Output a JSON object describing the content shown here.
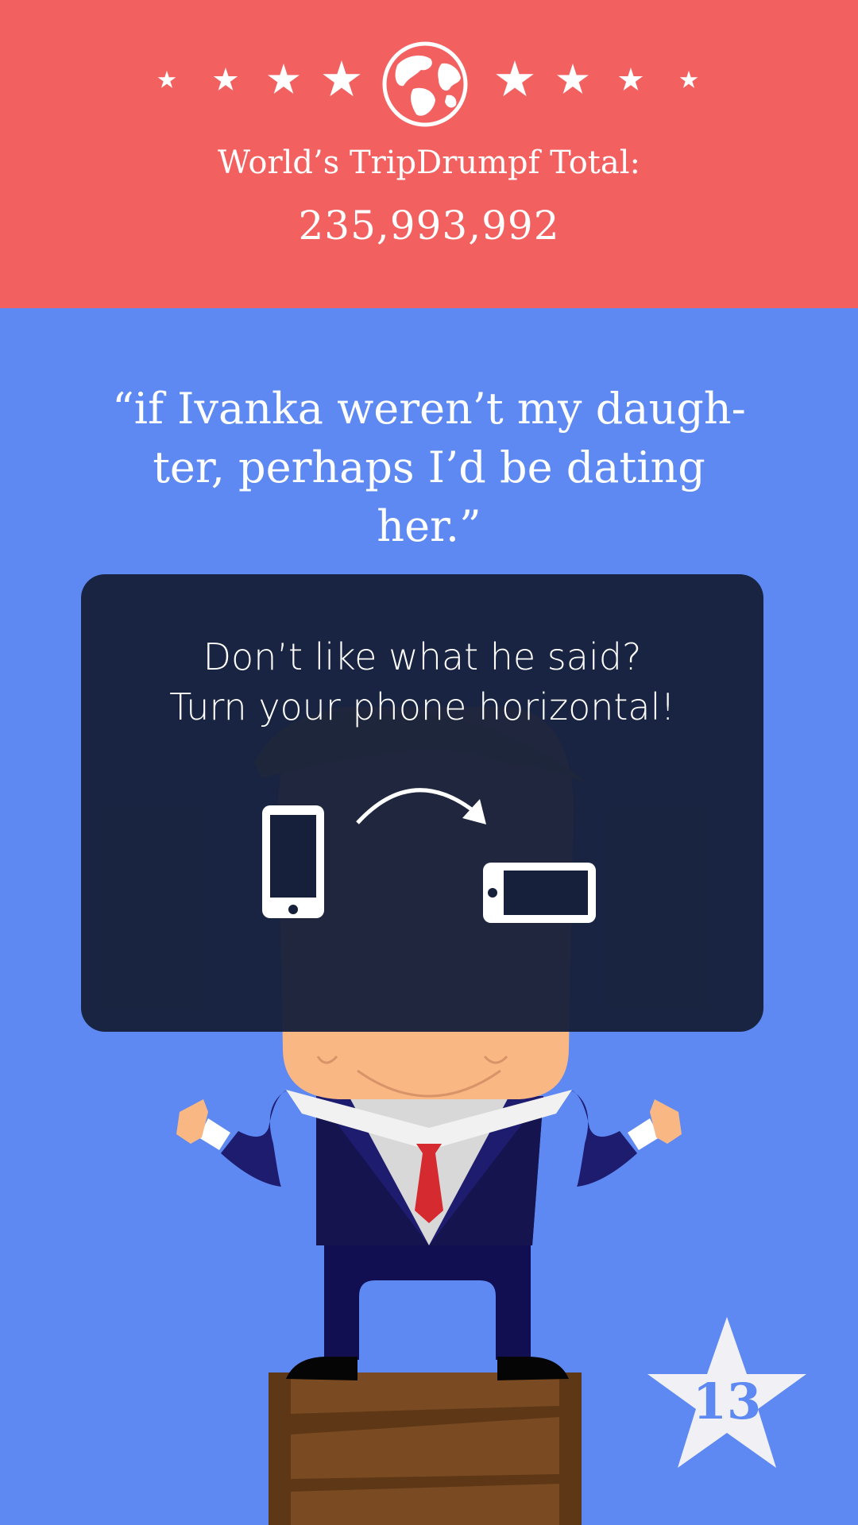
{
  "header": {
    "title": "World’s TripDrumpf Total:",
    "total": "235,993,992",
    "colors": {
      "background": "#f26060",
      "text": "#ffffff"
    },
    "icons": [
      "star-icon",
      "globe-icon"
    ]
  },
  "quote": {
    "line1": "“if Ivanka weren’t my daugh-",
    "line2": "ter, perhaps I’d be dating her.”"
  },
  "overlay": {
    "line1": "Don’t like what he said?",
    "line2": "Turn your phone horizontal!",
    "icons": [
      "phone-portrait-icon",
      "rotate-arrow-icon",
      "phone-landscape-icon"
    ]
  },
  "level": {
    "number": "13"
  },
  "colors": {
    "background": "#5e89f2",
    "overlay": "#16203a",
    "crate": "#7a4a22"
  }
}
